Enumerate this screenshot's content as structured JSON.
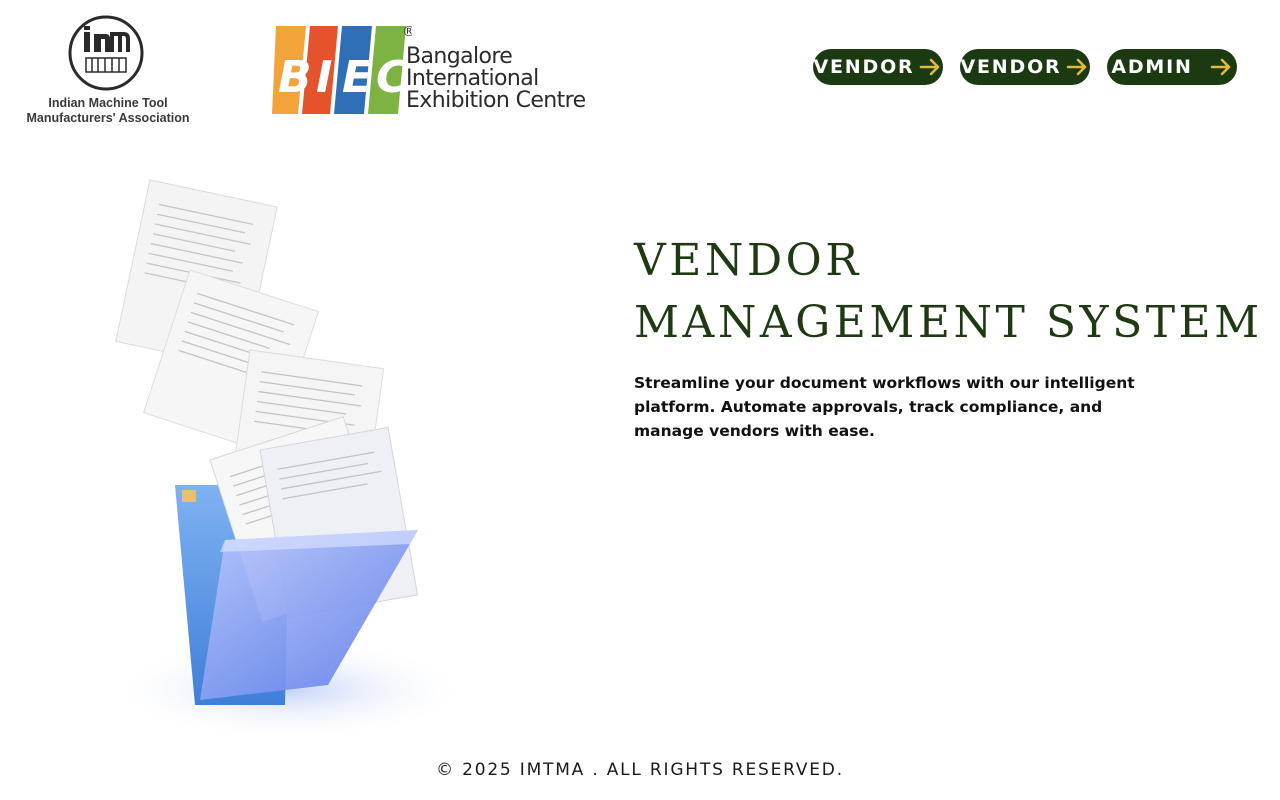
{
  "header": {
    "imtma_logo": {
      "mark_text": "im1",
      "name_line1": "Indian Machine Tool",
      "name_line2": "Manufacturers' Association"
    },
    "biec_logo": {
      "letters": [
        "B",
        "I",
        "E",
        "C"
      ],
      "registered": "®",
      "name_line1": "Bangalore",
      "name_line2": "International",
      "name_line3": "Exhibition Centre",
      "colors": [
        "#f2a43a",
        "#e4532c",
        "#2f6fb8",
        "#7cb342"
      ]
    },
    "nav": [
      {
        "label": "VENDOR"
      },
      {
        "label": "VENDOR"
      },
      {
        "label": "ADMIN"
      }
    ]
  },
  "hero": {
    "title_line1": "VENDOR",
    "title_line2": "MANAGEMENT SYSTEM",
    "description": "Streamline your document workflows with our intelligent platform. Automate approvals, track compliance, and manage vendors with ease."
  },
  "footer": {
    "copyright": "© 2025 IMTMA . ALL RIGHTS RESERVED."
  },
  "theme": {
    "primary": "#1c3a12",
    "arrow": "#e2b93b",
    "title": "#1f3a12",
    "folder": "#6f8ff0"
  }
}
